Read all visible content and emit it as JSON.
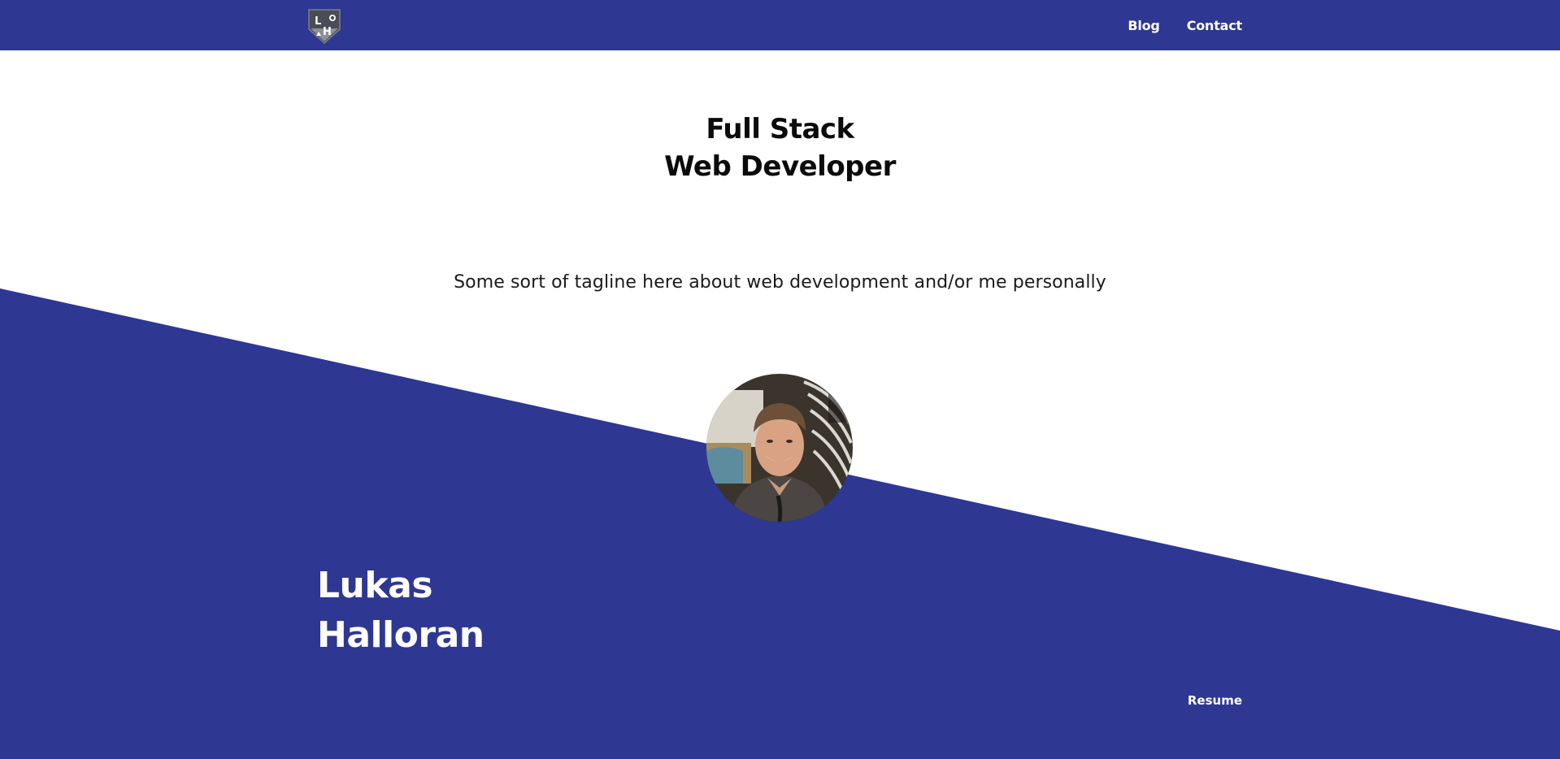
{
  "colors": {
    "brand": "#2e3792",
    "background": "#ffffff",
    "heading_text": "#0b0b0b",
    "inverse_text": "#ffffff"
  },
  "nav": {
    "logo_icon": "shield-monogram-logo",
    "logo_letters": "LH",
    "links": [
      {
        "label": "Blog"
      },
      {
        "label": "Contact"
      }
    ]
  },
  "hero": {
    "title_line1": "Full Stack",
    "title_line2": "Web Developer",
    "tagline": "Some sort of tagline here about web development and/or me personally"
  },
  "profile": {
    "avatar_icon": "profile-photo",
    "first_name": "Lukas",
    "last_name": "Halloran"
  },
  "footer_links": {
    "resume": "Resume"
  }
}
